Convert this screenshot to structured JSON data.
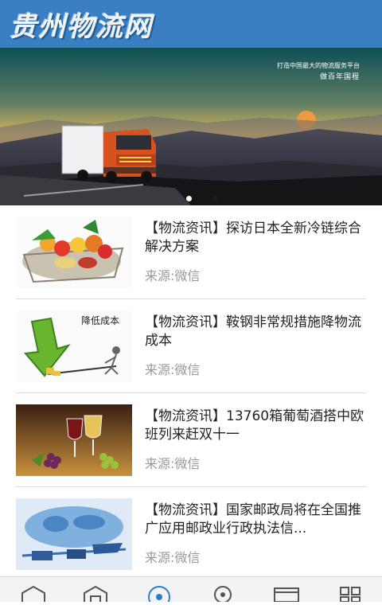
{
  "header": {
    "logo_text": "贵州物流网"
  },
  "banner": {
    "slogan_line1": "打造中国最大的物流服务平台",
    "slogan_line2": "做百年国程",
    "dots_total": 2,
    "dots_active_index": 0
  },
  "news": [
    {
      "title": "【物流资讯】探访日本全新冷链综合解决方案",
      "source": "来源:微信",
      "thumb": "vegetables-basket-image"
    },
    {
      "title": "【物流资讯】鞍钢非常规措施降物流成本",
      "source": "来源:微信",
      "thumb": "cost-reduction-image",
      "thumb_caption": "降低成本"
    },
    {
      "title": "【物流资讯】13760箱葡萄酒搭中欧班列来赶双十一",
      "source": "来源:微信",
      "thumb": "wine-grapes-image"
    },
    {
      "title": "【物流资讯】国家邮政局将在全国推广应用邮政业行政执法信...",
      "source": "来源:微信",
      "thumb": "global-logistics-image"
    }
  ],
  "tabbar": [
    "home-icon",
    "home-outline-icon",
    "target-icon",
    "location-pin-icon",
    "browser-window-icon",
    "grid-icon"
  ],
  "colors": {
    "header_bg": "#3a7fc1",
    "source_text": "#999999",
    "title_text": "#222222",
    "divider": "#dddddd",
    "tab_icon": "#555555",
    "tab_icon_active": "#2a7fd4"
  }
}
